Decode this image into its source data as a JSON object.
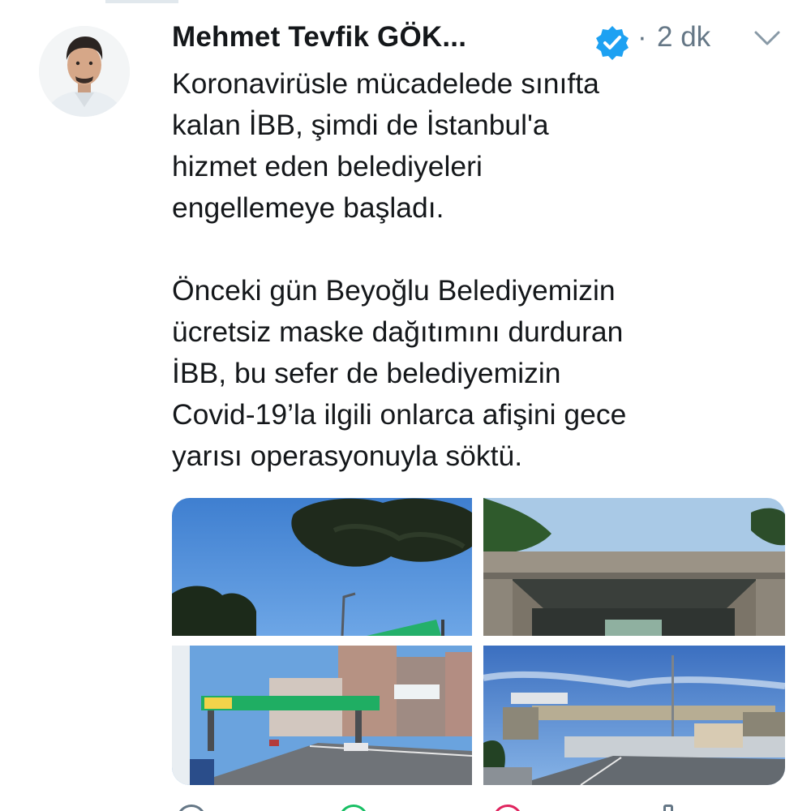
{
  "tweet": {
    "author_name": "Mehmet Tevfik GÖK...",
    "separator": "·",
    "time": "2 dk",
    "paragraphs": [
      "Koronavirüsle mücadelede sınıfta\nkalan İBB, şimdi de İstanbul'a\nhizmet eden belediyeleri\nengellemeye başladı.",
      "Önceki gün Beyoğlu Belediyemizin\nücretsiz maske dağıtımını durduran\nİBB, bu sefer de belediyemizin\nCovid-19’la ilgili onlarca afişini gece\nyarısı operasyonuyla söktü."
    ]
  },
  "icons": {
    "verified": "verified-badge-icon",
    "more": "chevron-down-icon"
  },
  "colors": {
    "text": "#14171a",
    "secondary": "#657786",
    "verified": "#1da1f2"
  }
}
